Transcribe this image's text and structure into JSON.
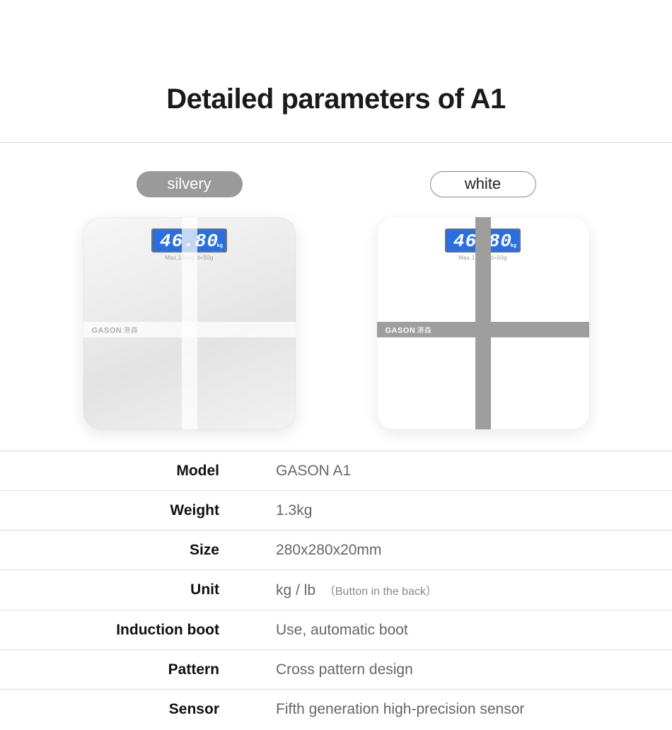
{
  "title": "Detailed parameters of A1",
  "variants": [
    {
      "label": "silvery",
      "style": "silvery"
    },
    {
      "label": "white",
      "style": "white"
    }
  ],
  "display": {
    "reading": "46.80",
    "sub": "Max.180kg d=50g",
    "brand": "GASON",
    "brand_cn": "港森"
  },
  "specs": [
    {
      "key": "Model",
      "val": "GASON A1"
    },
    {
      "key": "Weight",
      "val": "1.3kg"
    },
    {
      "key": "Size",
      "val": "280x280x20mm"
    },
    {
      "key": "Unit",
      "val": "kg / lb",
      "note": "（Button in the back）"
    },
    {
      "key": "Induction boot",
      "val": "Use, automatic boot"
    },
    {
      "key": "Pattern",
      "val": "Cross pattern design"
    },
    {
      "key": "Sensor",
      "val": "Fifth generation high-precision sensor"
    }
  ]
}
